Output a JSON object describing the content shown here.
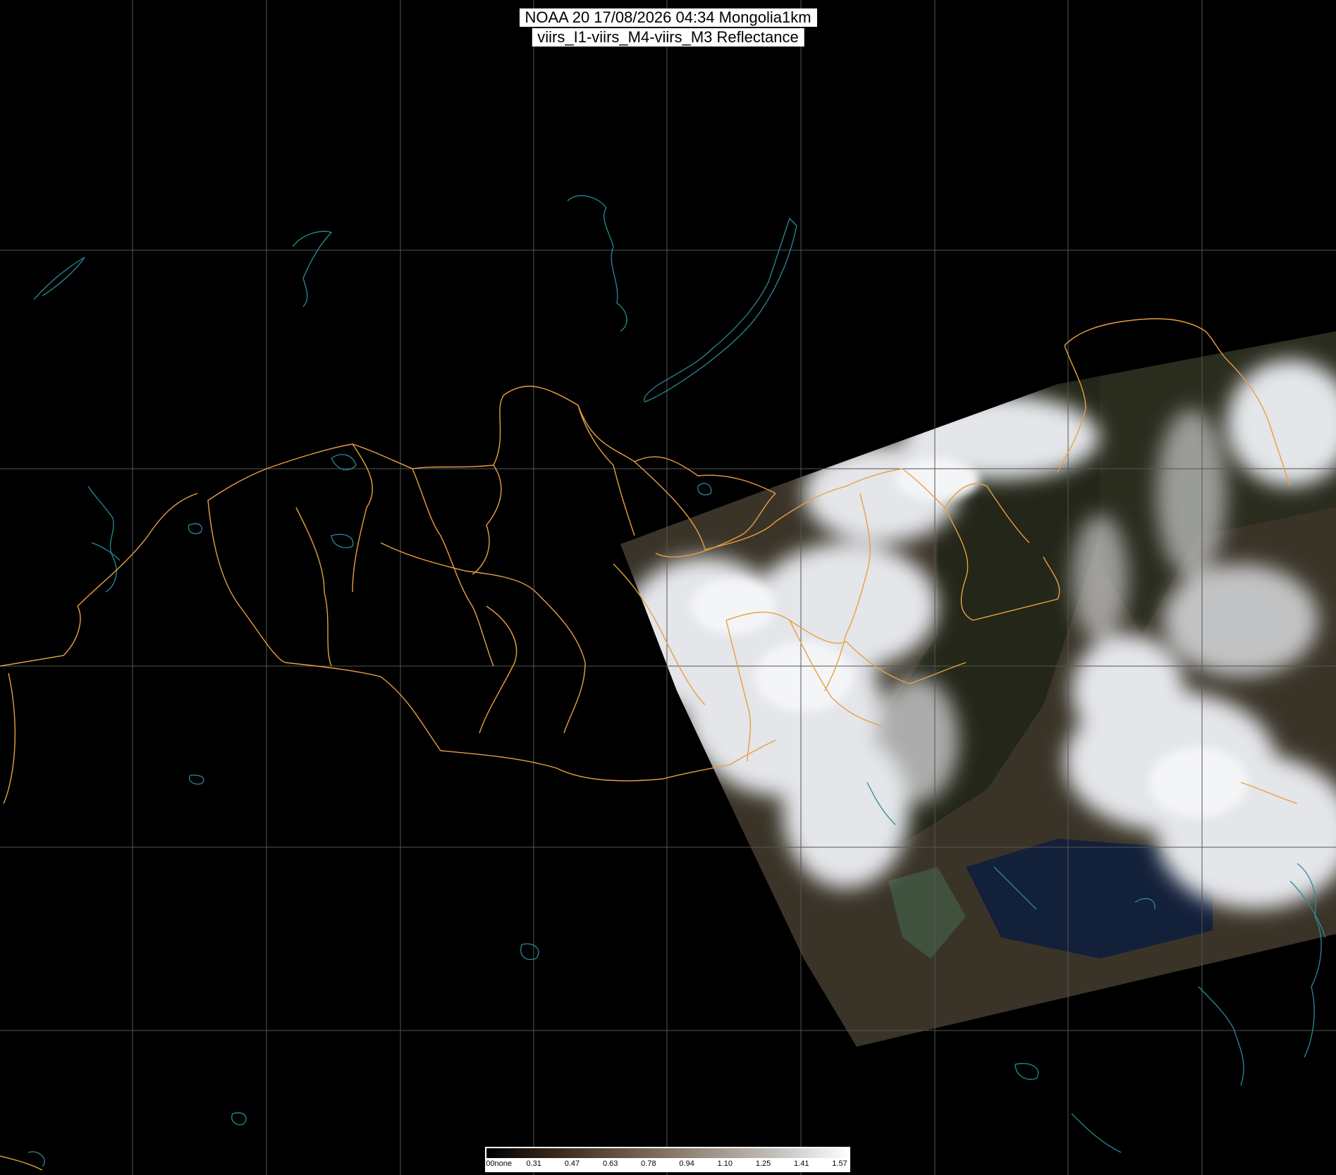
{
  "header": {
    "title_line1": "NOAA 20 17/08/2026 04:34 Mongolia1km",
    "title_line2": "viirs_I1-viirs_M4-viirs_M3 Reflectance"
  },
  "legend": {
    "ticks": [
      "0.00none",
      "0.31",
      "0.47",
      "0.63",
      "0.78",
      "0.94",
      "1.10",
      "1.25",
      "1.41",
      "1.57"
    ],
    "range": [
      0.0,
      1.57
    ],
    "gradient_colors": [
      "#000000",
      "#3a2a1e",
      "#6e5a48",
      "#9a8e82",
      "#c4c0bc",
      "#ffffff"
    ]
  },
  "colors": {
    "background": "#000000",
    "graticule": "#555555",
    "borders": "#e8a040",
    "coast_and_lakes": "#2a8a9a",
    "cloud": "#e6e8ec",
    "land": "#3a3428",
    "sea": "#14223a"
  }
}
